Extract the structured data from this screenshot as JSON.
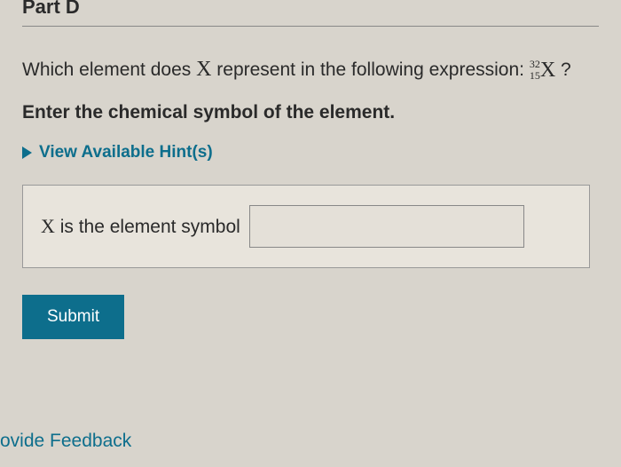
{
  "part": {
    "header": "Part D"
  },
  "question": {
    "prefix": "Which element does ",
    "variable": "X",
    "middle": " represent in the following expression: ",
    "nuclide_mass": "32",
    "nuclide_atomic": "15",
    "nuclide_symbol": "X",
    "suffix": " ?"
  },
  "instruction": "Enter the chemical symbol of the element.",
  "hints": {
    "label": "View Available Hint(s)"
  },
  "answer": {
    "label_var": "X",
    "label_rest": " is the element symbol",
    "value": ""
  },
  "submit_label": "Submit",
  "feedback_label": "ovide Feedback"
}
